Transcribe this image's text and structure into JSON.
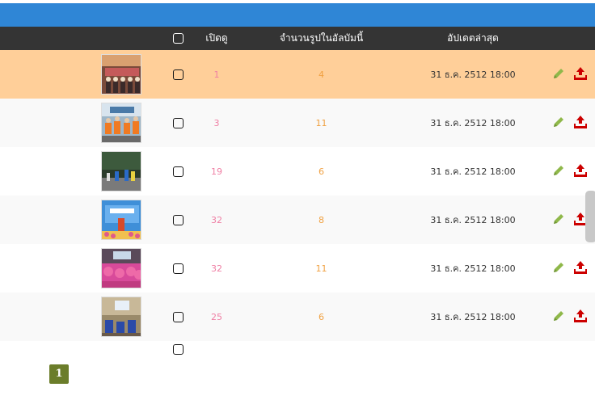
{
  "header": {
    "view_label": "เปิดดู",
    "count_label": "จำนวนรูปในอัลบัมนี้",
    "updated_label": "อัปเดตล่าสุด"
  },
  "rows": [
    {
      "views": "1",
      "photo_count": "4",
      "updated": "31 ธ.ค. 2512 18:00",
      "highlight": true
    },
    {
      "views": "3",
      "photo_count": "11",
      "updated": "31 ธ.ค. 2512 18:00",
      "highlight": false
    },
    {
      "views": "19",
      "photo_count": "6",
      "updated": "31 ธ.ค. 2512 18:00",
      "highlight": false
    },
    {
      "views": "32",
      "photo_count": "8",
      "updated": "31 ธ.ค. 2512 18:00",
      "highlight": false
    },
    {
      "views": "32",
      "photo_count": "11",
      "updated": "31 ธ.ค. 2512 18:00",
      "highlight": false
    },
    {
      "views": "25",
      "photo_count": "6",
      "updated": "31 ธ.ค. 2512 18:00",
      "highlight": false
    }
  ],
  "pagination": {
    "current_page": "1"
  },
  "colors": {
    "topbar": "#2f86d6",
    "header": "#343434",
    "highlight_row": "#ffcf99",
    "alt_row": "#f9f9f9",
    "edit_icon": "#8fb84a",
    "upload_icon": "#cc0000",
    "pager": "#6b7d2a"
  },
  "icons": {
    "edit": "pencil-icon",
    "upload": "upload-icon"
  }
}
